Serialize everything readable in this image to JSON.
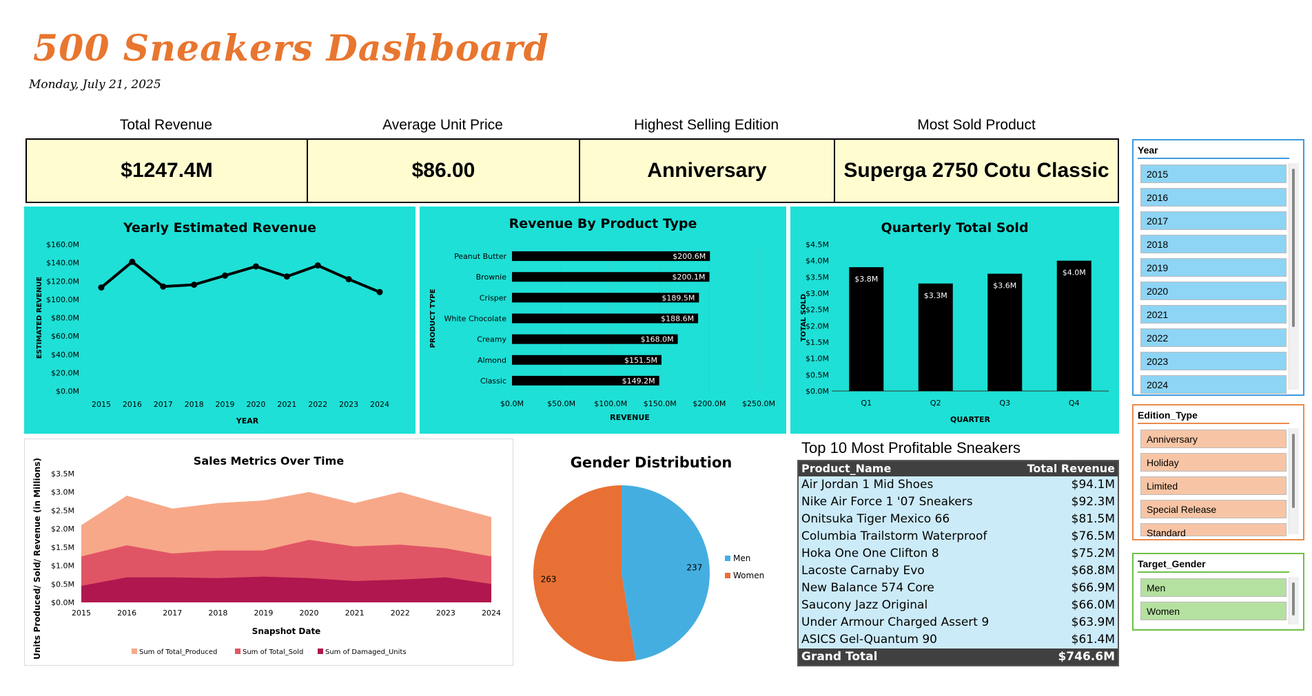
{
  "header": {
    "title": "500 Sneakers Dashboard",
    "date": "Monday, July 21, 2025"
  },
  "kpis": [
    {
      "label": "Total Revenue",
      "value": "$1247.4M"
    },
    {
      "label": "Average Unit Price",
      "value": "$86.00"
    },
    {
      "label": "Highest Selling Edition",
      "value": "Anniversary"
    },
    {
      "label": "Most Sold Product",
      "value": "Superga 2750 Cotu Classic"
    }
  ],
  "chart_data": [
    {
      "type": "line",
      "title": "Yearly Estimated Revenue",
      "xlabel": "YEAR",
      "ylabel": "ESTIMATED REVENUE",
      "x": [
        "2015",
        "2016",
        "2017",
        "2018",
        "2019",
        "2020",
        "2021",
        "2022",
        "2023",
        "2024"
      ],
      "values": [
        113,
        141,
        114,
        116,
        126,
        136,
        125,
        137,
        122,
        108
      ],
      "ylim": [
        0,
        160
      ],
      "yticks": [
        "$0.0M",
        "$20.0M",
        "$40.0M",
        "$60.0M",
        "$80.0M",
        "$100.0M",
        "$120.0M",
        "$140.0M",
        "$160.0M"
      ],
      "color": "#000000"
    },
    {
      "type": "bar",
      "orientation": "horizontal",
      "title": "Revenue By Product Type",
      "xlabel": "REVENUE",
      "ylabel": "PRODUCT TYPE",
      "categories": [
        "Peanut Butter",
        "Brownie",
        "Crisper",
        "White Chocolate",
        "Creamy",
        "Almond",
        "Classic"
      ],
      "values": [
        200.6,
        200.1,
        189.5,
        188.6,
        168.0,
        151.5,
        149.2
      ],
      "labels": [
        "$200.6M",
        "$200.1M",
        "$189.5M",
        "$188.6M",
        "$168.0M",
        "$151.5M",
        "$149.2M"
      ],
      "xlim": [
        0,
        250
      ],
      "xticks": [
        "$0.0M",
        "$50.0M",
        "$100.0M",
        "$150.0M",
        "$200.0M",
        "$250.0M"
      ]
    },
    {
      "type": "bar",
      "title": "Quarterly Total Sold",
      "xlabel": "QUARTER",
      "ylabel": "TOTAL SOLD",
      "categories": [
        "Q1",
        "Q2",
        "Q3",
        "Q4"
      ],
      "values": [
        3.8,
        3.3,
        3.6,
        4.0
      ],
      "labels": [
        "$3.8M",
        "$3.3M",
        "$3.6M",
        "$4.0M"
      ],
      "ylim": [
        0,
        4.5
      ],
      "yticks": [
        "$0.0M",
        "$0.5M",
        "$1.0M",
        "$1.5M",
        "$2.0M",
        "$2.5M",
        "$3.0M",
        "$3.5M",
        "$4.0M",
        "$4.5M"
      ]
    },
    {
      "type": "area",
      "title": "Sales Metrics Over Time",
      "xlabel": "Snapshot Date",
      "ylabel": "Units Produced/ Sold/ Revenue (in Millions)",
      "x": [
        "2015",
        "2016",
        "2017",
        "2018",
        "2019",
        "2020",
        "2021",
        "2022",
        "2023",
        "2024"
      ],
      "ylim": [
        0,
        3.5
      ],
      "yticks": [
        "$0.0M",
        "$0.5M",
        "$1.0M",
        "$1.5M",
        "$2.0M",
        "$2.5M",
        "$3.0M",
        "$3.5M"
      ],
      "series": [
        {
          "name": "Sum of Total_Produced",
          "color": "#F7A889",
          "values": [
            2.1,
            2.9,
            2.55,
            2.7,
            2.77,
            3.0,
            2.7,
            3.0,
            2.65,
            2.32
          ]
        },
        {
          "name": "Sum of Total_Sold",
          "color": "#E05565",
          "values": [
            1.25,
            1.55,
            1.33,
            1.41,
            1.41,
            1.7,
            1.52,
            1.57,
            1.47,
            1.25
          ]
        },
        {
          "name": "Sum of Damaged_Units",
          "color": "#B0174F",
          "values": [
            0.45,
            0.68,
            0.68,
            0.66,
            0.7,
            0.66,
            0.58,
            0.62,
            0.68,
            0.5
          ]
        }
      ]
    },
    {
      "type": "pie",
      "title": "Gender Distribution",
      "categories": [
        "Men",
        "Women"
      ],
      "values": [
        237,
        263
      ],
      "colors": [
        "#45AEE0",
        "#E87035"
      ]
    }
  ],
  "table": {
    "title": "Top 10 Most Profitable Sneakers",
    "headers": [
      "Product_Name",
      "Total Revenue"
    ],
    "rows": [
      [
        "Air Jordan 1 Mid Shoes",
        "$94.1M"
      ],
      [
        "Nike Air Force 1 '07 Sneakers",
        "$92.3M"
      ],
      [
        "Onitsuka Tiger Mexico 66",
        "$81.5M"
      ],
      [
        "Columbia Trailstorm Waterproof",
        "$76.5M"
      ],
      [
        "Hoka One One Clifton 8",
        "$75.2M"
      ],
      [
        "Lacoste Carnaby Evo",
        "$68.8M"
      ],
      [
        "New Balance 574 Core",
        "$66.9M"
      ],
      [
        "Saucony Jazz Original",
        "$66.0M"
      ],
      [
        "Under Armour Charged Assert 9",
        "$63.9M"
      ],
      [
        "ASICS Gel-Quantum 90",
        "$61.4M"
      ]
    ],
    "total_label": "Grand Total",
    "total_value": "$746.6M"
  },
  "slicers": [
    {
      "title": "Year",
      "border": "#3D9BE0",
      "fill": "#8ED4F4",
      "items": [
        "2015",
        "2016",
        "2017",
        "2018",
        "2019",
        "2020",
        "2021",
        "2022",
        "2023",
        "2024"
      ]
    },
    {
      "title": "Edition_Type",
      "border": "#EC8A4A",
      "fill": "#F7C5A5",
      "items": [
        "Anniversary",
        "Holiday",
        "Limited",
        "Special Release",
        "Standard"
      ]
    },
    {
      "title": "Target_Gender",
      "border": "#6DC045",
      "fill": "#B5E1A0",
      "items": [
        "Men",
        "Women"
      ]
    }
  ]
}
